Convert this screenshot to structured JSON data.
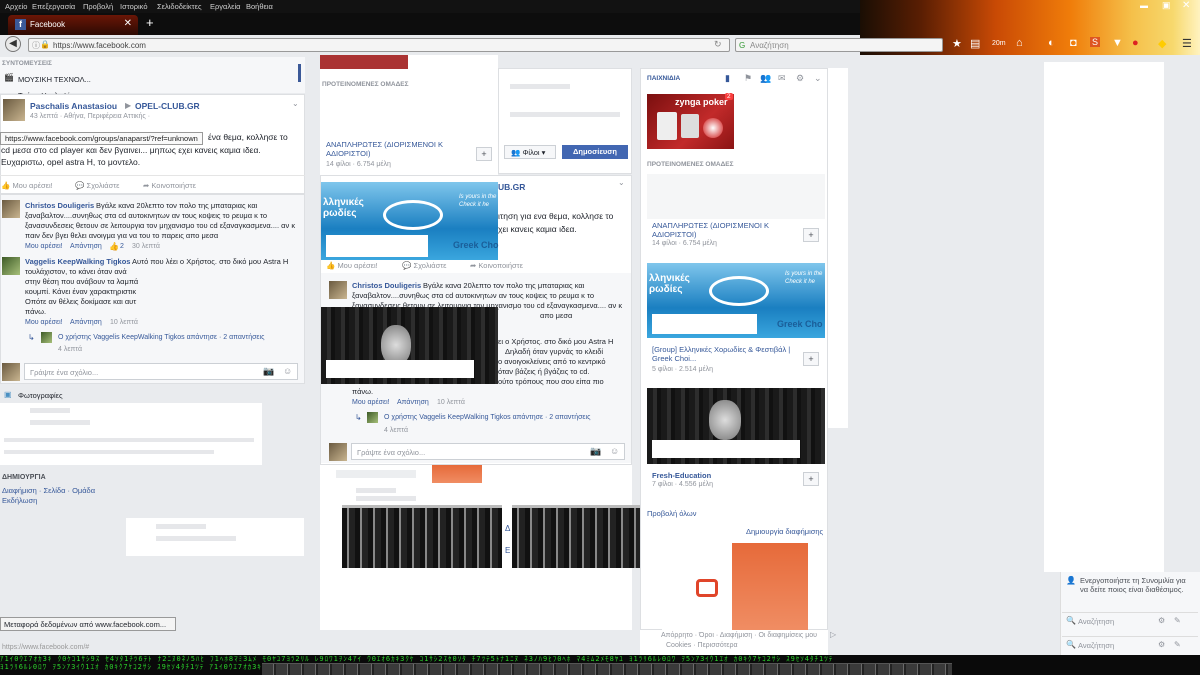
{
  "browser": {
    "menu": [
      "Αρχείο",
      "Επεξεργασία",
      "Προβολή",
      "Ιστορικό",
      "Σελιδοδείκτες",
      "Εργαλεία",
      "Βοήθεια"
    ],
    "tab_title": "Facebook",
    "url": "https://www.facebook.com",
    "search_placeholder": "Αναζήτηση",
    "status_url": "https://www.facebook.com/#",
    "status_transfer": "Μεταφορά δεδομένων από www.facebook.com...",
    "link_tooltip": "https://www.facebook.com/groups/anaparst/?ref=unknown",
    "toolbar_badge": "20m"
  },
  "left": {
    "shortcuts_label": "ΣΥΝΤΟΜΕΥΣΕΙΣ",
    "shortcut_1": "ΜΟΥΣΙΚΗ ΤΕΧΝΟΛ...",
    "shortcut_2": "Τμήμα Ηχοληψίας",
    "post": {
      "author": "Paschalis Anastasiou",
      "group": "OPEL-CLUB.GR",
      "meta": "43 λεπτά · Αθήνα, Περιφέρεια Αττικής · ",
      "text1": "ένα θεμα, κολλησε το",
      "text2": "cd μεσα στο cd player και δεν βγαινει... μηπως εχει κανεις καμια ιδεα.",
      "text3": "Ευχαριστω, opel astra H, το μοντελο.",
      "like": "Μου αρέσει!",
      "comment": "Σχολιάστε",
      "share": "Κοινοποιήστε"
    },
    "c1": {
      "author": "Christos Douligeris",
      "text1": "Βγάλε κανα 20λεπτο τον πολο της μπαταριας και",
      "text2": "ξαναβαλτον....συνηθως στα cd αυτοκινητων αν τους κοψεις το ρευμα κ το",
      "text3": "ξανασυνδεσεις θετουν σε λειτουργια τον μηχανισμο του cd εξαναγκασμενα.... αν κ",
      "text4": "παιν δεν βγει θελει ανοιγμα για να του το παρεις απο μεσα",
      "like": "Μου αρέσει!",
      "reply": "Απάντηση",
      "count": "2",
      "time": "30 λεπτά"
    },
    "c2": {
      "author": "Vaggelis KeepWalking Tigkos",
      "text1": "Αυτό που λέει ο Χρήστος. στο δικό μου Astra H",
      "text2": "τουλάχιστον, το κάνει όταν ανά",
      "text3": "στην θέση που ανάβουν τα λαμπά",
      "text4": "κουμπί. Κάνει έναν χαρακτηριστικ",
      "text5": "Οπότε αν θέλεις δοκίμασε και αυτ",
      "text6": "πάνω.",
      "like": "Μου αρέσει!",
      "reply": "Απάντηση",
      "time": "10 λεπτά",
      "replied": "Ο χρήστης Vaggelis KeepWalking Tigkos απάντησε · 2 απαντήσεις",
      "replied_time": "4 λεπτά"
    },
    "write_comment": "Γράψτε ένα σχόλιο...",
    "photos": "Φωτογραφίες",
    "create_label": "ΔΗΜΙΟΥΡΓΙΑ",
    "create_links": "Διαφήμιση · Σελίδα · Ομάδα",
    "create_event": "Εκδήλωση"
  },
  "middle": {
    "suggested_groups": "ΠΡΟΤΕΙΝΟΜΕΝΕΣ ΟΜΑΔΕΣ",
    "group1_name": "ΑΝΑΠΛΗΡΩΤΕΣ (ΔΙΟΡΙΣΜΕΝΟΙ Κ ΑΔΙΟΡΙΣΤΟΙ)",
    "group1_meta": "14 φίλοι · 6.754 μέλη",
    "friends_button": "Φίλοι",
    "publish_button": "Δημοσίευση",
    "ellipsis": "...",
    "club_suffix": "UB.GR",
    "post_text1": "ιτηση για ενα θεμα, κολλησε το",
    "post_text2": "χει κανεις καμια ιδεα.",
    "blue_img_text": "λληνικές ρωδίες",
    "blue_img_tag1": "Is yours in the",
    "blue_img_tag2": "Check it he",
    "greek_cho": "Greek Cho",
    "like": "Μου αρέσει!",
    "comment": "Σχολιάστε",
    "share": "Κοινοποιήστε",
    "c1": {
      "author": "Christos Douligeris",
      "text1": "Βγάλε κανα 20λεπτο τον πολο της μπαταριας και",
      "text2": "ξαναβαλτον....συνηθως στα cd αυτοκινητων αν τους κοψεις το ρευμα κ το",
      "text3": "ξανασυνδεσεις θετουν σε λειτουργια τον μηχανισμο του cd εξαναγκασμενα.... αν κ",
      "text4": "απο μεσα"
    },
    "c2": {
      "text1": "ει ο Χρήστος. στο δικό μου Astra H",
      "text2": "Δηλαδή όταν γυρνάς το κλειδί",
      "text3": "ο ανοιγοκλείνεις από το κεντρικό",
      "text4": "όταν βάζεις ή βγάζεις το cd.",
      "text5": "ούτο τρόπους που σου είπα πιο",
      "text6": "πάνω.",
      "like": "Μου αρέσει!",
      "reply": "Απάντηση",
      "time": "10 λεπτά",
      "replied": "Ο χρήστης Vaggelis KeepWalking Tigkos απάντησε · 2 απαντήσεις",
      "replied_time": "4 λεπτά"
    },
    "write_comment": "Γράψτε ένα σχόλιο...",
    "d_label": "Δ",
    "e_label": "Ε"
  },
  "right": {
    "games_label": "ΠΑΙΧΝΙΔΙΑ",
    "zynga": "zynga poker",
    "zynga_badge": "2",
    "suggested_groups": "ΠΡΟΤΕΙΝΟΜΕΝΕΣ ΟΜΑΔΕΣ",
    "g1_name": "ΑΝΑΠΛΗΡΩΤΕΣ (ΔΙΟΡΙΣΜΕΝΟΙ Κ ΑΔΙΟΡΙΣΤΟΙ)",
    "g1_meta": "14 φίλοι · 6.754 μέλη",
    "g2_img_text": "λληνικές ρωδίες",
    "g2_tag1": "Is yours in the",
    "g2_tag2": "Check it he",
    "g2_cho": "Greek Cho",
    "g2_name": "[Group] Ελληνικές Χορωδίες & Φεστιβάλ | Greek Choi...",
    "g2_meta": "5 φίλοι · 2.514 μέλη",
    "g3_name": "Fresh-Education",
    "g3_meta": "7 φίλοι · 4.556 μέλη",
    "see_all": "Προβολή όλων",
    "create_ad": "Δημιουργία διαφήμισης",
    "footer1": "Απόρρητο · Όροι · Διαφήμιση · Οι διαφημίσεις μου",
    "footer2": "Cookies · Περισσότερα"
  },
  "chat": {
    "notice": "Ενεργοποιήστε τη Συνομιλία για να δείτε ποιος είναι διαθέσιμος.",
    "search1": "Αναζήτηση",
    "search2": "Αναζήτηση"
  }
}
